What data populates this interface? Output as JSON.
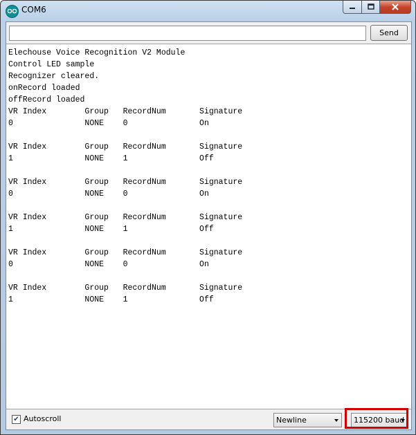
{
  "window": {
    "title": "COM6",
    "icon": "arduino-icon"
  },
  "toolbar": {
    "input_value": "",
    "send_label": "Send"
  },
  "output": {
    "lines": [
      "Elechouse Voice Recognition V2 Module",
      "Control LED sample",
      "Recognizer cleared.",
      "onRecord loaded",
      "offRecord loaded",
      "VR Index        Group   RecordNum       Signature",
      "0               NONE    0               On",
      "",
      "VR Index        Group   RecordNum       Signature",
      "1               NONE    1               Off",
      "",
      "VR Index        Group   RecordNum       Signature",
      "0               NONE    0               On",
      "",
      "VR Index        Group   RecordNum       Signature",
      "1               NONE    1               Off",
      "",
      "VR Index        Group   RecordNum       Signature",
      "0               NONE    0               On",
      "",
      "VR Index        Group   RecordNum       Signature",
      "1               NONE    1               Off"
    ]
  },
  "footer": {
    "autoscroll_label": "Autoscroll",
    "autoscroll_checked": true,
    "line_ending": "Newline",
    "baud_rate": "115200 baud"
  },
  "colors": {
    "highlight": "#d20000",
    "close_button": "#c7452c"
  }
}
